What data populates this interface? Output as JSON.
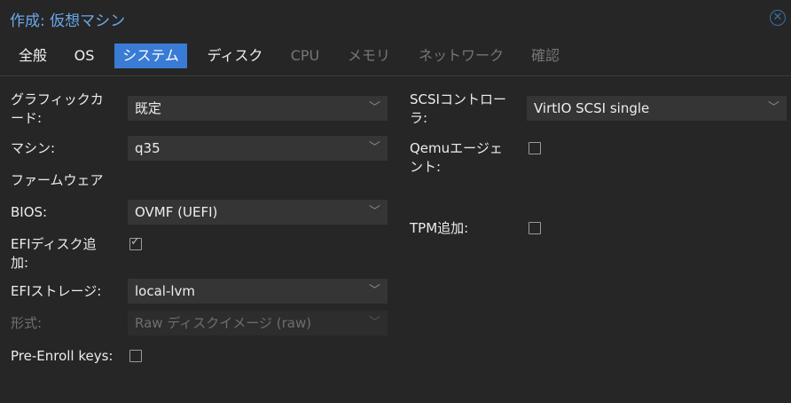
{
  "window": {
    "title": "作成: 仮想マシン",
    "close_icon": "close-circle-icon"
  },
  "tabs": [
    {
      "label": "全般",
      "state": "normal"
    },
    {
      "label": "OS",
      "state": "normal"
    },
    {
      "label": "システム",
      "state": "active"
    },
    {
      "label": "ディスク",
      "state": "normal"
    },
    {
      "label": "CPU",
      "state": "disabled"
    },
    {
      "label": "メモリ",
      "state": "disabled"
    },
    {
      "label": "ネットワーク",
      "state": "disabled"
    },
    {
      "label": "確認",
      "state": "disabled"
    }
  ],
  "left": {
    "graphics_label_1": "グラフィックカ",
    "graphics_label_2": "ード:",
    "graphics_value": "既定",
    "machine_label": "マシン:",
    "machine_value": "q35",
    "firmware_heading": "ファームウェア",
    "bios_label": "BIOS:",
    "bios_value": "OVMF (UEFI)",
    "efidisk_label_1": "EFIディスク追",
    "efidisk_label_2": "加:",
    "efidisk_checked": true,
    "efistorage_label": "EFIストレージ:",
    "efistorage_value": "local-lvm",
    "format_label": "形式:",
    "format_value": "Raw ディスクイメージ (raw)",
    "preenroll_label": "Pre-Enroll keys:",
    "preenroll_checked": false
  },
  "right": {
    "scsi_label_1": "SCSIコントロー",
    "scsi_label_2": "ラ:",
    "scsi_value": "VirtIO SCSI single",
    "qemu_label_1": "Qemuエージェ",
    "qemu_label_2": "ント:",
    "qemu_checked": false,
    "tpm_label": "TPM追加:",
    "tpm_checked": false
  },
  "colors": {
    "accent": "#3a7bd5",
    "title": "#6aa8ea",
    "background": "#262626"
  }
}
